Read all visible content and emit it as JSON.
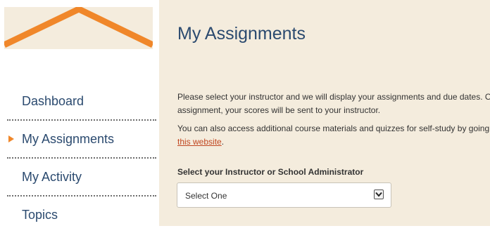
{
  "sidebar": {
    "items": [
      {
        "label": "Dashboard",
        "active": false
      },
      {
        "label": "My Assignments",
        "active": true
      },
      {
        "label": "My Activity",
        "active": false
      },
      {
        "label": "Topics",
        "active": false
      }
    ]
  },
  "main": {
    "title": "My Assignments",
    "para1_line1": "Please select your instructor and we will display your assignments and due dates. O",
    "para1_line2": "assignment, your scores will be sent to your instructor.",
    "para2_line1": "You can also access additional course materials and quizzes for self-study by going",
    "para2_link": "this website",
    "para2_after_link": ".",
    "field_label": "Select your Instructor or School Administrator",
    "select_value": "Select One"
  },
  "colors": {
    "accent": "#f0872a",
    "title": "#2b4a6f",
    "link": "#c0461f",
    "background": "#f4ecdd"
  },
  "icons": {
    "logo": "roof-logo-icon",
    "active_marker": "triangle-right-icon",
    "dropdown": "chevron-down-icon"
  }
}
